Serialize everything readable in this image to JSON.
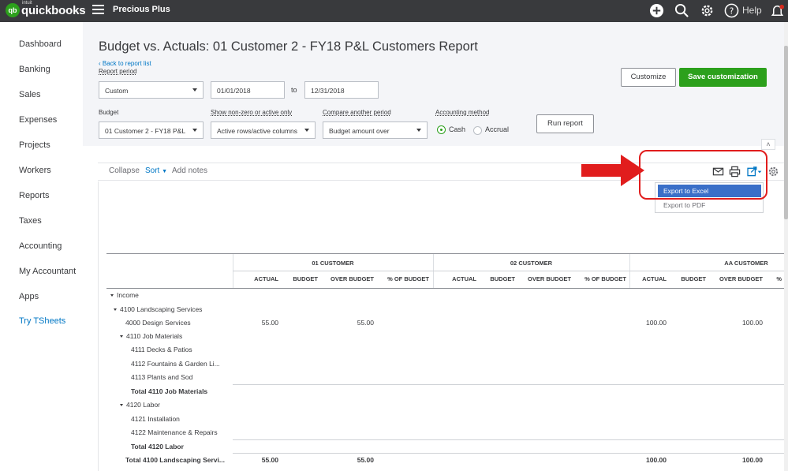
{
  "topbar": {
    "logo_text": "qb",
    "brand_small": "intuit",
    "brand": "quickbooks",
    "company": "Precious Plus",
    "help_label": "Help",
    "icons": [
      "plus-icon",
      "search-icon",
      "gear-icon",
      "help-icon",
      "bell-icon"
    ]
  },
  "sidebar": {
    "items": [
      "Dashboard",
      "Banking",
      "Sales",
      "Expenses",
      "Projects",
      "Workers",
      "Reports",
      "Taxes",
      "Accounting",
      "My Accountant",
      "Apps",
      "Try TSheets"
    ]
  },
  "header": {
    "title": "Budget vs. Actuals: 01 Customer 2 - FY18 P&L Customers Report",
    "back_link": "Back to report list",
    "report_period_label": "Report period",
    "period_value": "Custom",
    "date_from": "01/01/2018",
    "to_label": "to",
    "date_to": "12/31/2018",
    "customize_label": "Customize",
    "save_customization_label": "Save customization",
    "budget_label": "Budget",
    "budget_value": "01 Customer 2 - FY18 P&L",
    "show_label": "Show non-zero or active only",
    "show_value": "Active rows/active columns",
    "compare_label": "Compare another period",
    "compare_value": "Budget amount over",
    "method_label": "Accounting method",
    "method_cash": "Cash",
    "method_accrual": "Accrual",
    "run_report_label": "Run report"
  },
  "toolbar": {
    "collapse": "Collapse",
    "sort": "Sort",
    "add_notes": "Add notes",
    "icons": [
      "email-icon",
      "print-icon",
      "export-icon",
      "settings-icon"
    ]
  },
  "export_menu": {
    "items": [
      "Export to Excel",
      "Export to PDF"
    ],
    "highlighted": "Export to Excel"
  },
  "annotation": {
    "color": "#e11d1d"
  },
  "table": {
    "groups": [
      "01 CUSTOMER",
      "02 CUSTOMER",
      "AA CUSTOMER"
    ],
    "columns": [
      "ACTUAL",
      "BUDGET",
      "OVER BUDGET",
      "% OF BUDGET",
      "ACTUAL",
      "BUDGET",
      "OVER BUDGET",
      "% OF BUDGET",
      "ACTUAL",
      "BUDGET",
      "OVER BUDGET",
      "%"
    ],
    "rows": [
      {
        "label": "Income",
        "c0": "",
        "c2": "",
        "c8": "",
        "c10": ""
      },
      {
        "label": "4100 Landscaping Services",
        "c0": "",
        "c2": "",
        "c8": "",
        "c10": ""
      },
      {
        "label": "4000 Design Services",
        "c0": "55.00",
        "c2": "55.00",
        "c8": "100.00",
        "c10": "100.00"
      },
      {
        "label": "4110 Job Materials",
        "c0": "",
        "c2": "",
        "c8": "",
        "c10": ""
      },
      {
        "label": "4111 Decks & Patios",
        "c0": "",
        "c2": "",
        "c8": "",
        "c10": ""
      },
      {
        "label": "4112 Fountains & Garden Li...",
        "c0": "",
        "c2": "",
        "c8": "",
        "c10": ""
      },
      {
        "label": "4113 Plants and Sod",
        "c0": "",
        "c2": "",
        "c8": "",
        "c10": ""
      },
      {
        "label": "Total 4110 Job Materials",
        "c0": "",
        "c2": "",
        "c8": "",
        "c10": ""
      },
      {
        "label": "4120 Labor",
        "c0": "",
        "c2": "",
        "c8": "",
        "c10": ""
      },
      {
        "label": "4121 Installation",
        "c0": "",
        "c2": "",
        "c8": "",
        "c10": ""
      },
      {
        "label": "4122 Maintenance & Repairs",
        "c0": "",
        "c2": "",
        "c8": "",
        "c10": ""
      },
      {
        "label": "Total 4120 Labor",
        "c0": "",
        "c2": "",
        "c8": "",
        "c10": ""
      },
      {
        "label": "Total 4100 Landscaping Servi...",
        "c0": "55.00",
        "c2": "55.00",
        "c8": "100.00",
        "c10": "100.00"
      }
    ]
  }
}
